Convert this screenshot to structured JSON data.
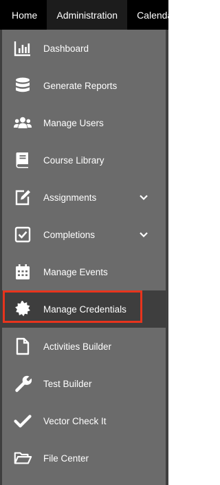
{
  "topnav": {
    "tabs": [
      {
        "label": "Home"
      },
      {
        "label": "Administration"
      },
      {
        "label": "Calendar"
      }
    ]
  },
  "sidebar": {
    "items": [
      {
        "label": "Dashboard",
        "icon": "bar-chart-icon"
      },
      {
        "label": "Generate Reports",
        "icon": "database-icon"
      },
      {
        "label": "Manage Users",
        "icon": "users-icon"
      },
      {
        "label": "Course Library",
        "icon": "book-icon"
      },
      {
        "label": "Assignments",
        "icon": "edit-icon",
        "expandable": true
      },
      {
        "label": "Completions",
        "icon": "checkbox-icon",
        "expandable": true
      },
      {
        "label": "Manage Events",
        "icon": "calendar-icon"
      },
      {
        "label": "Manage Credentials",
        "icon": "badge-icon",
        "active": true,
        "highlighted": true
      },
      {
        "label": "Activities Builder",
        "icon": "file-icon"
      },
      {
        "label": "Test Builder",
        "icon": "wrench-icon"
      },
      {
        "label": "Vector Check It",
        "icon": "checkmark-icon"
      },
      {
        "label": "File Center",
        "icon": "folder-open-icon"
      }
    ]
  },
  "colors": {
    "topbar": "#000000",
    "sidebar": "#6b6b6b",
    "active_item": "#3e3e3e",
    "highlight_border": "#e8341d",
    "text": "#ffffff"
  }
}
